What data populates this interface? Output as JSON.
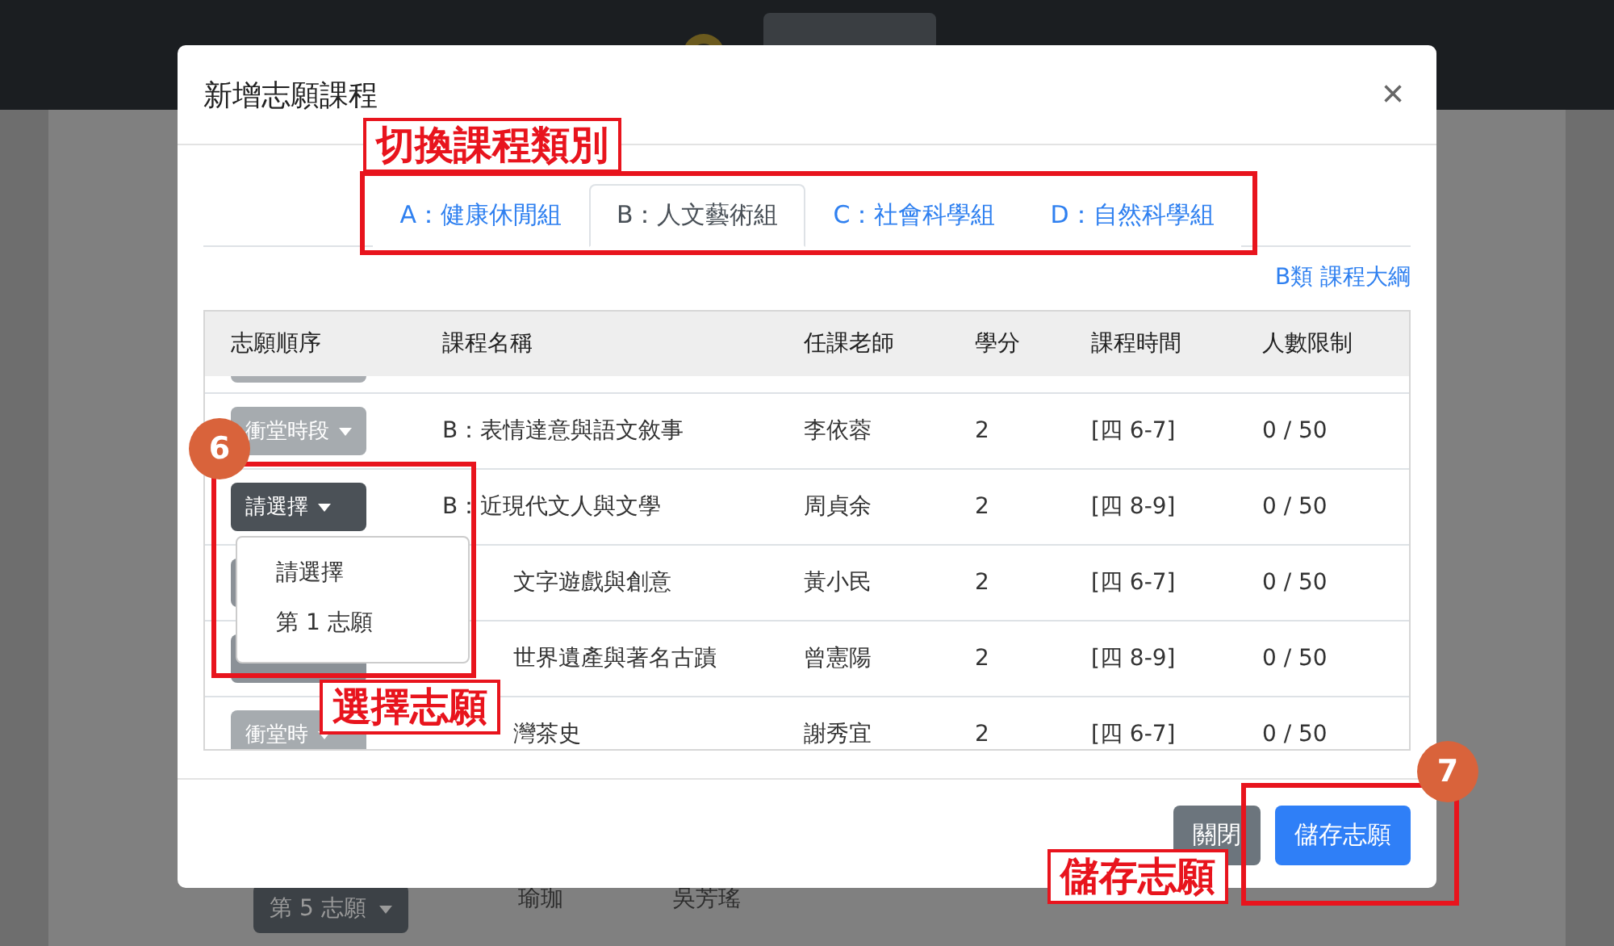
{
  "background": {
    "row": {
      "choice": "第 5 志願",
      "course": "瑜珈",
      "teacher": "吳芳瑤"
    }
  },
  "modal": {
    "title": "新增志願課程",
    "close": "×",
    "tabs": [
      {
        "label": "A：健康休閒組",
        "selected": false
      },
      {
        "label": "B：人文藝術組",
        "selected": true
      },
      {
        "label": "C：社會科學組",
        "selected": false
      },
      {
        "label": "D：自然科學組",
        "selected": false
      }
    ],
    "syllabus_link": "B類 課程大綱",
    "columns": [
      "志願順序",
      "課程名稱",
      "任課老師",
      "學分",
      "課程時間",
      "人數限制"
    ],
    "rows": [
      {
        "kind": "conflict",
        "open": false,
        "choice": "衝堂時段",
        "course": "B：表情達意與語文敘事",
        "teacher": "李依蓉",
        "credits": "2",
        "time": "[四 6-7]",
        "limit": "0 / 50",
        "covered": false
      },
      {
        "kind": "select",
        "open": true,
        "choice": "請選擇",
        "course": "B：近現代文人與文學",
        "teacher": "周貞余",
        "credits": "2",
        "time": "[四 8-9]",
        "limit": "0 / 50",
        "covered": false
      },
      {
        "kind": "select",
        "open": false,
        "course": "文字遊戲與創意",
        "teacher": "黃小民",
        "credits": "2",
        "time": "[四 6-7]",
        "limit": "0 / 50",
        "covered": true
      },
      {
        "kind": "select",
        "open": false,
        "course": "世界遺產與著名古蹟",
        "teacher": "曾憲陽",
        "credits": "2",
        "time": "[四 8-9]",
        "limit": "0 / 50",
        "covered": true
      },
      {
        "kind": "conflict",
        "open": false,
        "choice": "衝堂時",
        "course": "灣茶史",
        "teacher": "謝秀宜",
        "credits": "2",
        "time": "[四 6-7]",
        "limit": "0 / 50",
        "covered": true
      }
    ],
    "menu": {
      "items": [
        "請選擇",
        "第 1 志願"
      ]
    },
    "buttons": [
      {
        "label": "關閉",
        "kind": "secondary"
      },
      {
        "label": "儲存志願",
        "kind": "primary"
      }
    ]
  },
  "annotations": [
    {
      "label": "切換課程類別"
    },
    {
      "number": "6",
      "label": "選擇志願"
    },
    {
      "number": "7",
      "label": "儲存志願"
    }
  ]
}
